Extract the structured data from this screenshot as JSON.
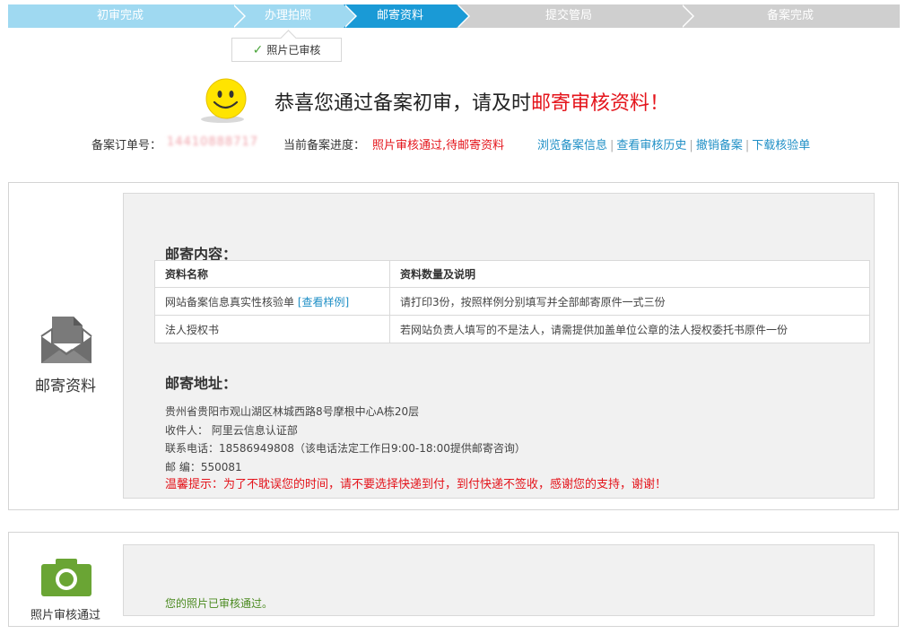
{
  "steps": [
    {
      "label": "初审完成",
      "state": "done"
    },
    {
      "label": "办理拍照",
      "state": "done"
    },
    {
      "label": "邮寄资料",
      "state": "current"
    },
    {
      "label": "提交管局",
      "state": "todo"
    },
    {
      "label": "备案完成",
      "state": "todo"
    }
  ],
  "photo_tag": "照片已审核",
  "headline": {
    "main": "恭喜您通过备案初审，请及时",
    "highlight": "邮寄审核资料！"
  },
  "order": {
    "label": "备案订单号：",
    "number": "14410888717",
    "progress_label": "当前备案进度：",
    "progress_value": "照片审核通过,待邮寄资料",
    "links": [
      "浏览备案信息",
      "查看审核历史",
      "撤销备案",
      "下载核验单"
    ]
  },
  "mail_section": {
    "side_label": "邮寄资料",
    "content_title": "邮寄内容：",
    "table": {
      "headers": [
        "资料名称",
        "资料数量及说明"
      ],
      "rows": [
        {
          "name": "网站备案信息真实性核验单",
          "link": "[查看样例]",
          "desc": "请打印3份，按照样例分别填写并全部邮寄原件一式三份"
        },
        {
          "name": "法人授权书",
          "link": "",
          "desc": "若网站负责人填写的不是法人，请需提供加盖单位公章的法人授权委托书原件一份"
        }
      ]
    },
    "address_title": "邮寄地址：",
    "address_lines": [
      "贵州省贵阳市观山湖区林城西路8号摩根中心A栋20层",
      "收件人：  阿里云信息认证部",
      "联系电话：18586949808（该电话法定工作日9:00-18:00提供邮寄咨询）",
      "邮 编：550081"
    ],
    "tip": "温馨提示：为了不耽误您的时间，请不要选择快递到付，到付快递不签收，感谢您的支持，谢谢！"
  },
  "photo_section": {
    "side_label": "照片审核通过",
    "message": "您的照片已审核通过。"
  },
  "colors": {
    "step_done": "#9fd9f1",
    "step_current": "#1a9ad6",
    "step_todo": "#cfcfcf",
    "accent_red": "#e4141b",
    "link_blue": "#1f8fc6",
    "camera_green": "#6aa534"
  },
  "icons": [
    "check-icon",
    "smiley-icon",
    "mail-icon",
    "camera-icon"
  ]
}
